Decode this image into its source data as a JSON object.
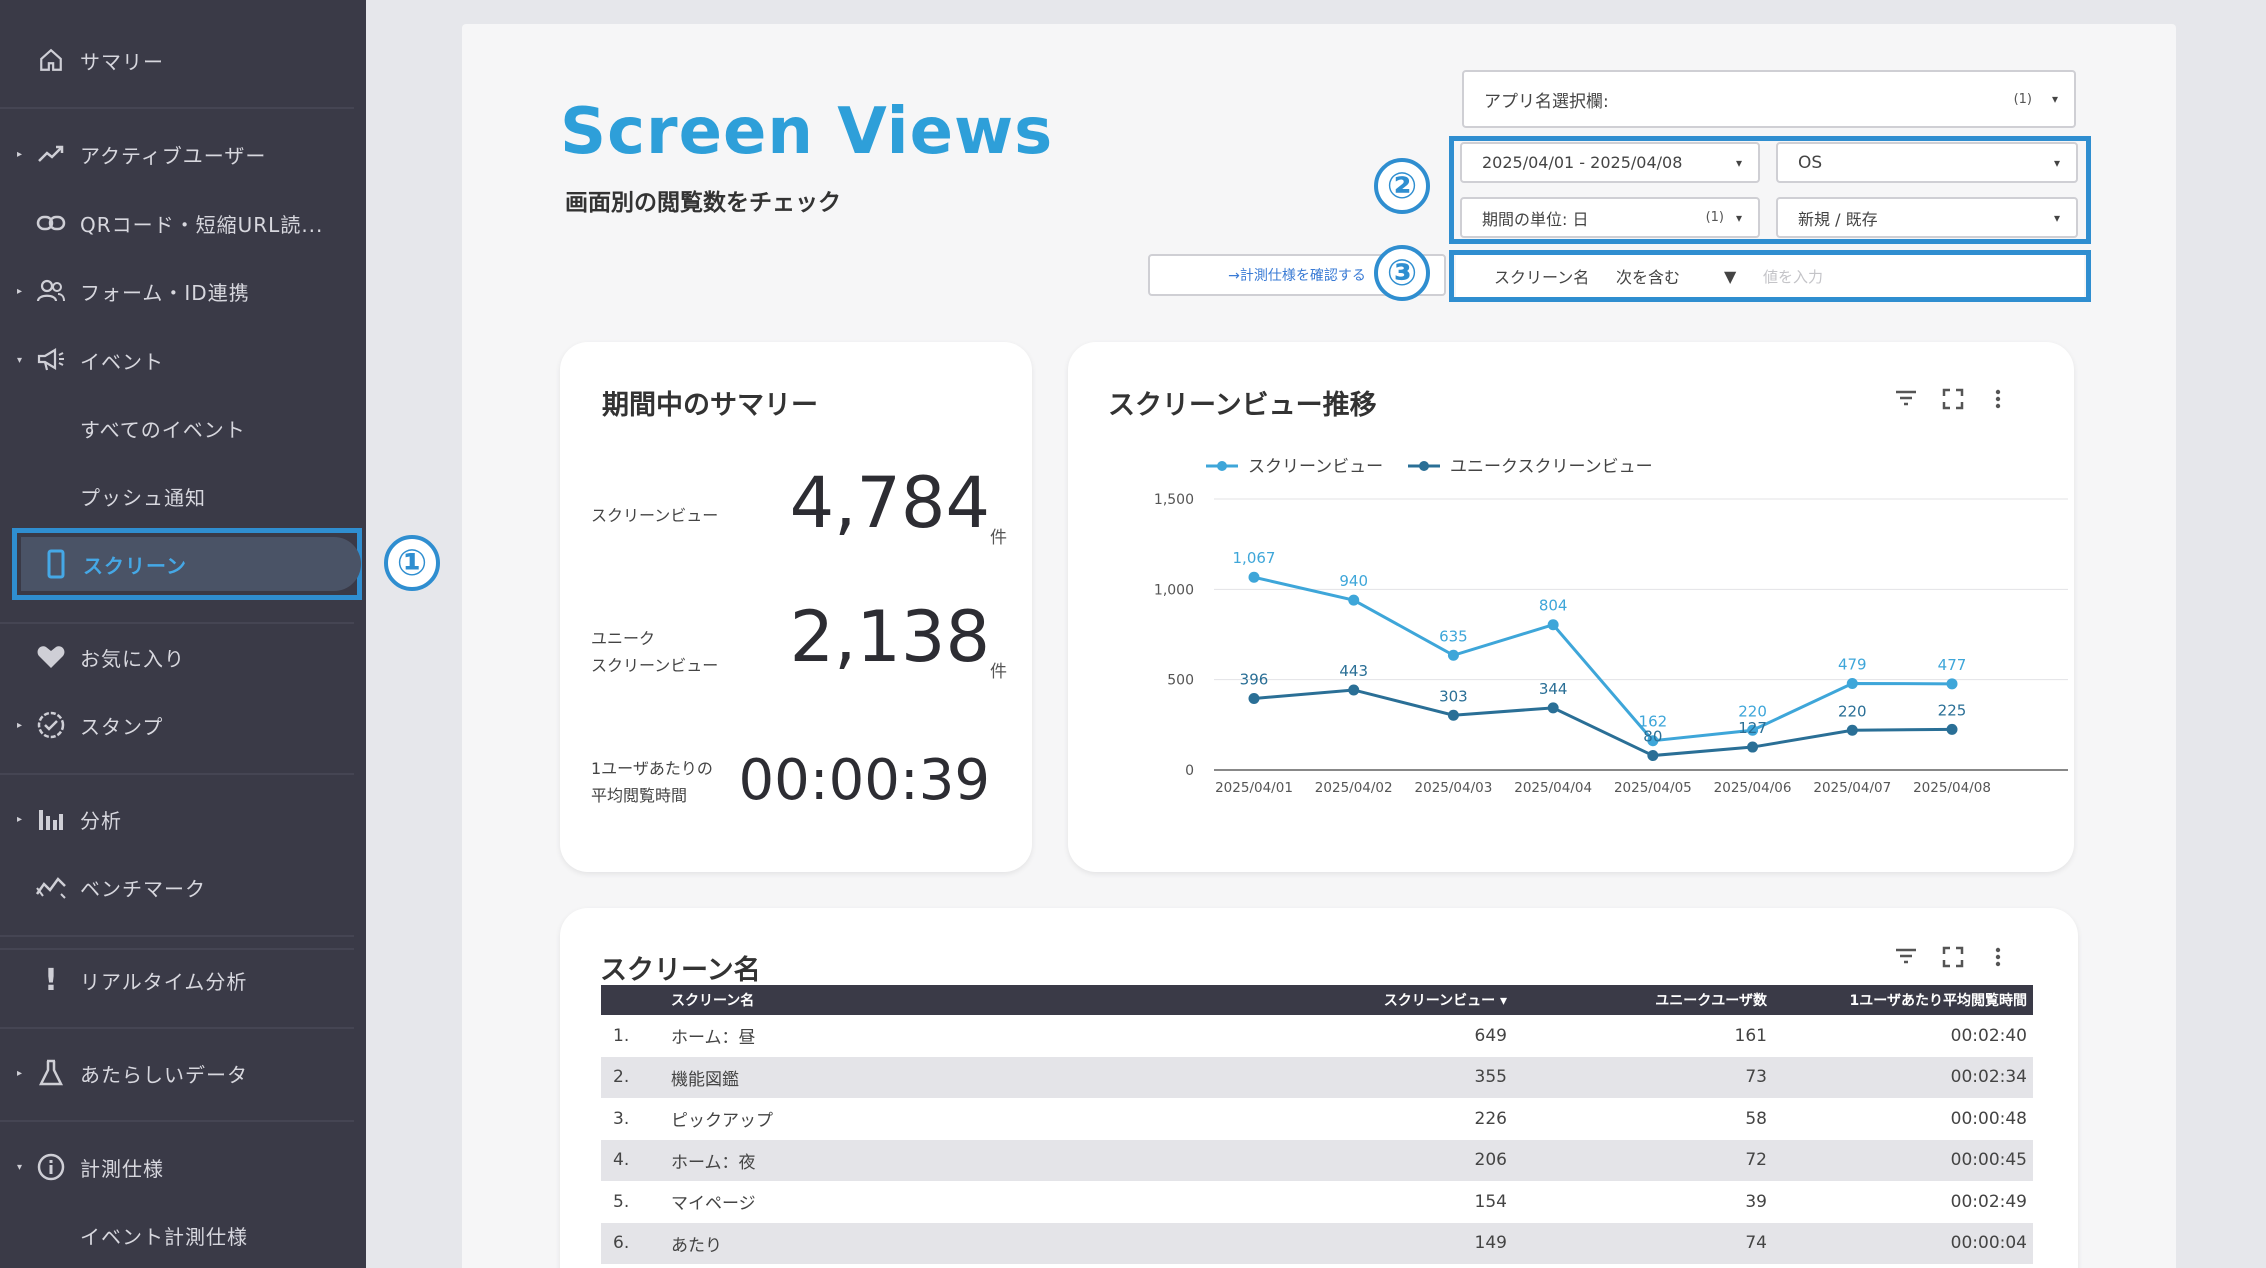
{
  "sidebar": {
    "items": [
      {
        "label": "サマリー",
        "icon": "home-icon"
      },
      {
        "label": "アクティブユーザー",
        "icon": "trend-icon"
      },
      {
        "label": "QRコード・短縮URL読...",
        "icon": "link-icon"
      },
      {
        "label": "フォーム・ID連携",
        "icon": "users-icon"
      },
      {
        "label": "イベント",
        "icon": "megaphone-icon"
      },
      {
        "label": "すべてのイベント",
        "icon": ""
      },
      {
        "label": "プッシュ通知",
        "icon": ""
      },
      {
        "label": "スクリーン",
        "icon": "phone-icon"
      },
      {
        "label": "お気に入り",
        "icon": "heart-icon"
      },
      {
        "label": "スタンプ",
        "icon": "badge-icon"
      },
      {
        "label": "分析",
        "icon": "bars-icon"
      },
      {
        "label": "ベンチマーク",
        "icon": "benchmark-icon"
      },
      {
        "label": "リアルタイム分析",
        "icon": "exclamation-icon"
      },
      {
        "label": "あたらしいデータ",
        "icon": "flask-icon"
      },
      {
        "label": "計測仕様",
        "icon": "info-icon"
      },
      {
        "label": "イベント計測仕様",
        "icon": ""
      }
    ],
    "marker": "①"
  },
  "header": {
    "title": "Screen Views",
    "subtitle": "画面別の閲覧数をチェック"
  },
  "filters": {
    "app_select": "アプリ名選択欄:",
    "app_select_count": "(1)",
    "date_range": "2025/04/01 - 2025/04/08",
    "os": "OS",
    "period_unit": "期間の単位: 日",
    "period_unit_count": "(1)",
    "new_existing": "新規 / 既存",
    "spec_link": "→計測仕様を確認する",
    "screen_name_field": "スクリーン名",
    "match_type": "次を含む",
    "value_placeholder": "値を入力",
    "marker2": "②",
    "marker3": "③"
  },
  "summary": {
    "title": "期間中のサマリー",
    "screen_views_label": "スクリーンビュー",
    "screen_views_value": "4,784",
    "unique_label_1": "ユニーク",
    "unique_label_2": "スクリーンビュー",
    "unique_value": "2,138",
    "avg_label_1": "1ユーザあたりの",
    "avg_label_2": "平均閲覧時間",
    "avg_value": "00:00:39",
    "unit": "件"
  },
  "trend": {
    "title": "スクリーンビュー推移"
  },
  "chart_data": {
    "type": "line",
    "x": [
      "2025/04/01",
      "2025/04/02",
      "2025/04/03",
      "2025/04/04",
      "2025/04/05",
      "2025/04/06",
      "2025/04/07",
      "2025/04/08"
    ],
    "series": [
      {
        "name": "スクリーンビュー",
        "values": [
          1067,
          940,
          635,
          804,
          162,
          220,
          479,
          477
        ],
        "color": "#3ea6d9"
      },
      {
        "name": "ユニークスクリーンビュー",
        "values": [
          396,
          443,
          303,
          344,
          80,
          127,
          220,
          225
        ],
        "color": "#2a6f96"
      }
    ],
    "yticks": [
      "0",
      "500",
      "1,000",
      "1,500"
    ],
    "ylim": [
      0,
      1500
    ],
    "grid": true,
    "legend": "top-left"
  },
  "table": {
    "title": "スクリーン名",
    "headers": [
      "",
      "スクリーン名",
      "スクリーンビュー ▾",
      "ユニークユーザ数",
      "1ユーザあたり平均閲覧時間"
    ],
    "rows": [
      {
        "rank": "1.",
        "name": "ホーム：昼",
        "views": "649",
        "users": "161",
        "time": "00:02:40"
      },
      {
        "rank": "2.",
        "name": "機能図鑑",
        "views": "355",
        "users": "73",
        "time": "00:02:34"
      },
      {
        "rank": "3.",
        "name": "ピックアップ",
        "views": "226",
        "users": "58",
        "time": "00:00:48"
      },
      {
        "rank": "4.",
        "name": "ホーム：夜",
        "views": "206",
        "users": "72",
        "time": "00:00:45"
      },
      {
        "rank": "5.",
        "name": "マイページ",
        "views": "154",
        "users": "39",
        "time": "00:02:49"
      },
      {
        "rank": "6.",
        "name": "あたり",
        "views": "149",
        "users": "74",
        "time": "00:00:04"
      }
    ]
  }
}
